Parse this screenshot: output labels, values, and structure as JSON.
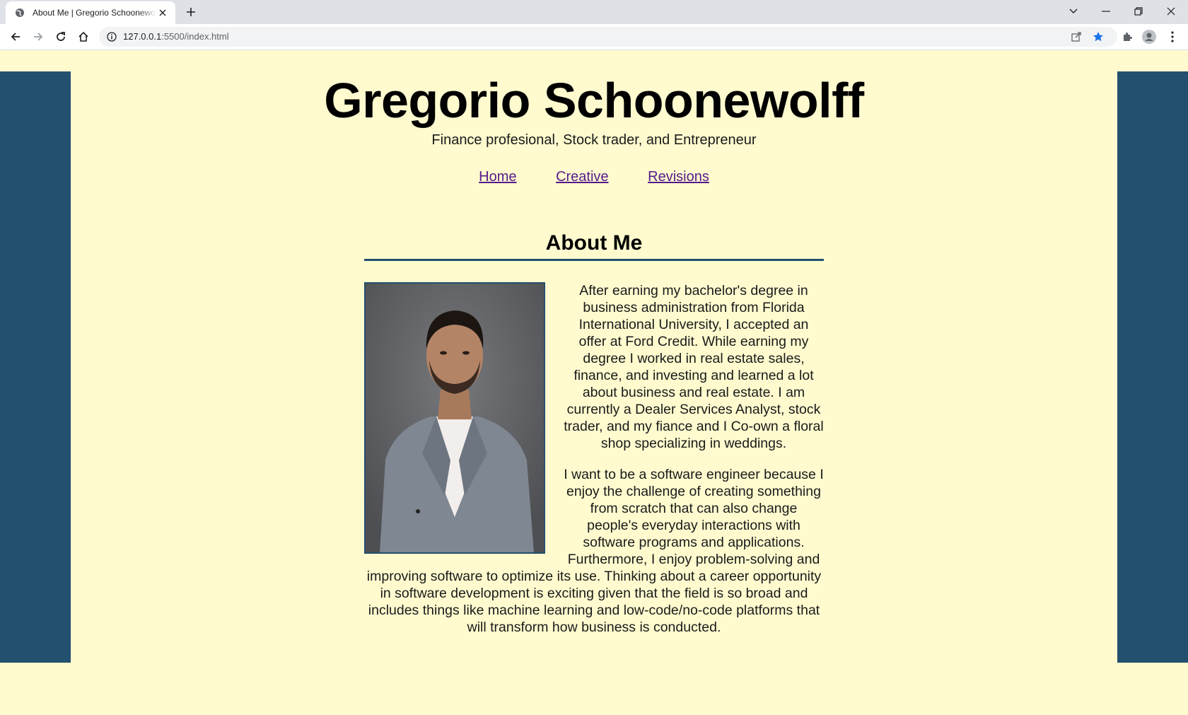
{
  "browser": {
    "tab_title": "About Me | Gregorio Schoonewolff",
    "url_host": "127.0.0.1",
    "url_path": ":5500/index.html",
    "icons": [
      "globe-icon",
      "close-icon",
      "plus-icon",
      "chevron-down-icon",
      "minimize-icon",
      "restore-icon",
      "window-close-icon",
      "back-icon",
      "forward-icon",
      "reload-icon",
      "home-icon",
      "info-icon",
      "share-icon",
      "star-icon",
      "puzzle-icon",
      "profile-icon",
      "menu-icon"
    ],
    "accent_color": "#1a73e8"
  },
  "page": {
    "title": "Gregorio Schoonewolff",
    "subtitle": "Finance profesional, Stock trader, and Entrepreneur",
    "nav": [
      {
        "label": "Home"
      },
      {
        "label": "Creative"
      },
      {
        "label": "Revisions"
      }
    ],
    "section_title": "About Me",
    "paragraphs": [
      "After earning my bachelor's degree in business administration from Florida International University, I accepted an offer at Ford Credit. While earning my degree I worked in real estate sales, finance, and investing and learned a lot about business and real estate. I am currently a Dealer Services Analyst, stock trader, and my fiance and I Co-own a floral shop specializing in weddings.",
      "I want to be a software engineer because I enjoy the challenge of creating something from scratch that can also change people's everyday interactions with software programs and applications. Furthermore, I enjoy problem-solving and improving software to optimize its use. Thinking about a career opportunity in software development is exciting given that the field is so broad and includes things like machine learning and low-code/no-code platforms that will transform how business is conducted."
    ],
    "colors": {
      "background": "#fffbcf",
      "side_bars": "#24506f",
      "link": "#551a8b"
    }
  }
}
